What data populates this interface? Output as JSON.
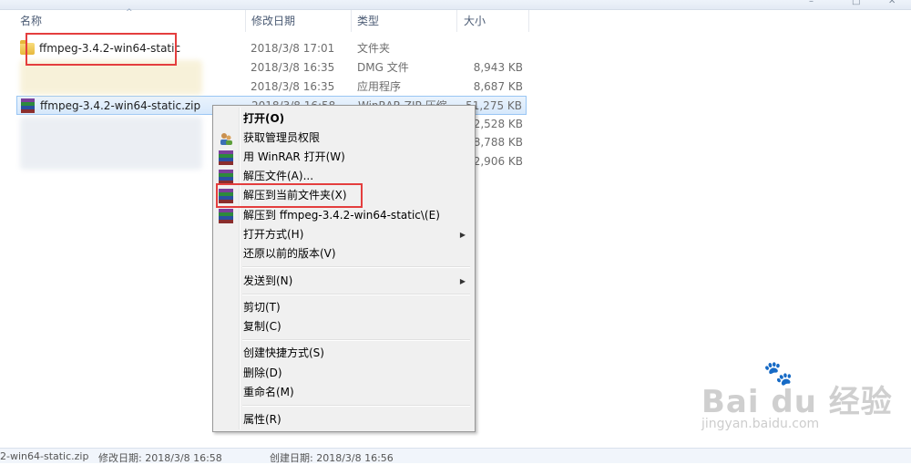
{
  "header": {
    "col_name": "名称",
    "col_date": "修改日期",
    "col_type": "类型",
    "col_size": "大小"
  },
  "files": [
    {
      "name": "ffmpeg-3.4.2-win64-static",
      "date": "2018/3/8 17:01",
      "type": "文件夹",
      "size": "",
      "icon": "folder-icon"
    },
    {
      "name": "",
      "date": "2018/3/8 16:35",
      "type": "DMG 文件",
      "size": "8,943 KB",
      "icon": "blurred"
    },
    {
      "name": "",
      "date": "2018/3/8 16:35",
      "type": "应用程序",
      "size": "8,687 KB",
      "icon": "blurred"
    },
    {
      "name": "ffmpeg-3.4.2-win64-static.zip",
      "date": "2018/3/8 16:58",
      "type": "WinRAR ZIP 压缩...",
      "size": "51,275 KB",
      "icon": "winrar-icon"
    },
    {
      "name": "",
      "date": "",
      "type": "",
      "size": "2,528 KB",
      "icon": "blurred"
    },
    {
      "name": "",
      "date": "",
      "type": "",
      "size": "18,788 KB",
      "icon": "blurred"
    },
    {
      "name": "",
      "date": "",
      "type": "",
      "size": "12,906 KB",
      "icon": "blurred"
    }
  ],
  "context_menu": {
    "items": [
      {
        "label": "打开(O)",
        "icon": ""
      },
      {
        "label": "获取管理员权限",
        "icon": "admin-users-icon"
      },
      {
        "label": "用 WinRAR 打开(W)",
        "icon": "winrar-icon"
      },
      {
        "label": "解压文件(A)...",
        "icon": "winrar-icon"
      },
      {
        "label": "解压到当前文件夹(X)",
        "icon": "winrar-icon"
      },
      {
        "label": "解压到 ffmpeg-3.4.2-win64-static\\(E)",
        "icon": "winrar-icon"
      },
      {
        "label": "打开方式(H)",
        "icon": "",
        "submenu": true
      },
      {
        "label": "还原以前的版本(V)",
        "icon": ""
      },
      {
        "label": "发送到(N)",
        "icon": "",
        "submenu": true
      },
      {
        "label": "剪切(T)",
        "icon": ""
      },
      {
        "label": "复制(C)",
        "icon": ""
      },
      {
        "label": "创建快捷方式(S)",
        "icon": ""
      },
      {
        "label": "删除(D)",
        "icon": ""
      },
      {
        "label": "重命名(M)",
        "icon": ""
      },
      {
        "label": "属性(R)",
        "icon": ""
      }
    ],
    "submenu_arrow": "▶"
  },
  "status_bar": {
    "filename": "2-win64-static.zip",
    "modified": "修改日期: 2018/3/8 16:58",
    "created": "创建日期: 2018/3/8 16:56"
  },
  "watermark": {
    "brand": "Bai du 经验",
    "url": "jingyan.baidu.com"
  },
  "colors": {
    "highlight_box": "#e43e3e",
    "selection": "#cce4fb",
    "menu_bg": "#f0f0f0"
  }
}
